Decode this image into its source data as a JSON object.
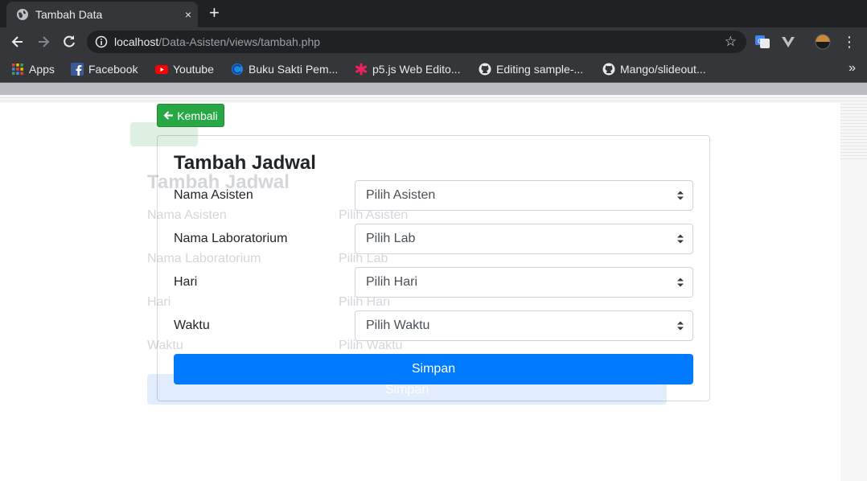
{
  "browser": {
    "tab_title": "Tambah Data",
    "tab_close": "×",
    "new_tab": "+",
    "url_host": "localhost",
    "url_path": "/Data-Asisten/views/tambah.php",
    "more_bookmarks": "»"
  },
  "bookmarks": [
    {
      "label": "Apps",
      "icon": "apps-grid-icon"
    },
    {
      "label": "Facebook",
      "icon": "facebook-icon"
    },
    {
      "label": "Youtube",
      "icon": "youtube-icon"
    },
    {
      "label": "Buku Sakti Pem...",
      "icon": "buku-sakti-icon"
    },
    {
      "label": "p5.js Web Edito...",
      "icon": "p5js-icon"
    },
    {
      "label": "Editing sample-...",
      "icon": "github-icon"
    },
    {
      "label": "Mango/slideout...",
      "icon": "github-icon"
    }
  ],
  "page": {
    "back_label": "Kembali",
    "form_title": "Tambah Jadwal",
    "fields": [
      {
        "label": "Nama Asisten",
        "placeholder": "Pilih Asisten"
      },
      {
        "label": "Nama Laboratorium",
        "placeholder": "Pilih Lab"
      },
      {
        "label": "Hari",
        "placeholder": "Pilih Hari"
      },
      {
        "label": "Waktu",
        "placeholder": "Pilih Waktu"
      }
    ],
    "submit_label": "Simpan"
  },
  "colors": {
    "back_button": "#28a745",
    "submit_button": "#007bff",
    "chrome_dark": "#202124",
    "chrome_toolbar": "#35363a"
  }
}
